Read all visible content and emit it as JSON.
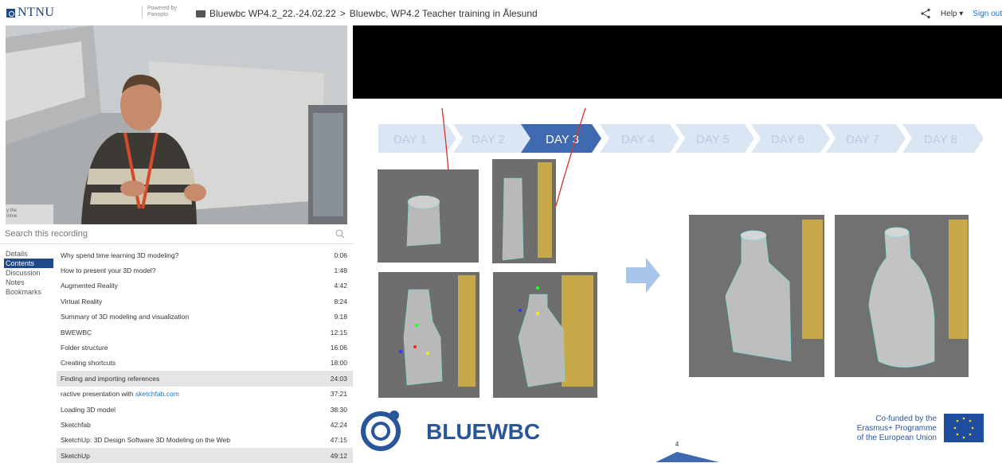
{
  "header": {
    "logo_text": "NTNU",
    "powered_line1": "Powered by",
    "powered_line2": "Panopto",
    "breadcrumb_folder": "Bluewbc WP4.2_22.-24.02.22",
    "breadcrumb_sep": ">",
    "breadcrumb_session": "Bluewbc, WP4.2 Teacher training in Ålesund",
    "help_label": "Help ▾",
    "signout_label": "Sign out"
  },
  "search": {
    "placeholder": "Search this recording"
  },
  "tabs": [
    {
      "label": "Details"
    },
    {
      "label": "Contents"
    },
    {
      "label": "Discussion"
    },
    {
      "label": "Notes"
    },
    {
      "label": "Bookmarks"
    }
  ],
  "contents": [
    {
      "title": "Why spend time learning 3D modeling?",
      "time": "0:06"
    },
    {
      "title": "How to present your 3D model?",
      "time": "1:48"
    },
    {
      "title": "Augmented Reality",
      "time": "4:42"
    },
    {
      "title": "Virtual Reality",
      "time": "8:24"
    },
    {
      "title": "Summary of 3D modeling and visualization",
      "time": "9:18"
    },
    {
      "title": "BWEWBC",
      "time": "12:15"
    },
    {
      "title": "Folder structure",
      "time": "16:06"
    },
    {
      "title": "Creating shortcuts",
      "time": "18:00"
    },
    {
      "title": "Finding and importing references",
      "time": "24:03"
    },
    {
      "title": "ractive presentation with ",
      "link": "sketchfab.com",
      "time": "37:21"
    },
    {
      "title": "Loading 3D model",
      "time": "38:30"
    },
    {
      "title": "Sketchfab",
      "time": "42:24"
    },
    {
      "title": "SketchUp: 3D Design Software 3D Modeling on the Web",
      "time": "47:15"
    },
    {
      "title": "SketchUp",
      "time": "49:12"
    }
  ],
  "slide": {
    "days": [
      "DAY 1",
      "DAY 2",
      "DAY 3",
      "DAY 4",
      "DAY 5",
      "DAY 6",
      "DAY 7",
      "DAY 8"
    ],
    "bluewbc": "BLUEWBC",
    "cofunded": [
      "Co-funded by the",
      "Erasmus+ Programme",
      "of the European Union"
    ],
    "page_number": "4",
    "webcam_text_1": "y the",
    "webcam_text_2": "mme"
  },
  "colors": {
    "accent": "#1f4a8a",
    "link": "#1a73c8",
    "day_active": "#3f6aaf",
    "day_inactive": "#dbe6f4",
    "day_inactive_text": "#b8cbe6"
  }
}
